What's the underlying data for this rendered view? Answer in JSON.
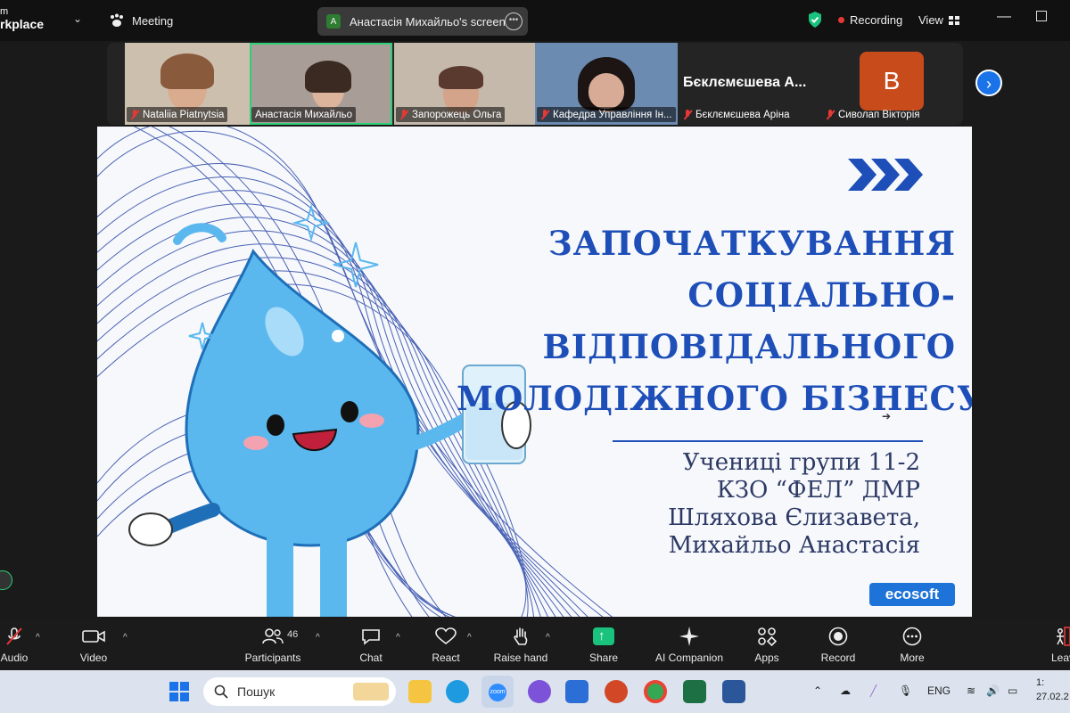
{
  "topbar": {
    "brand_line1": "m",
    "brand_line2": "rkplace",
    "meeting_label": "Meeting",
    "screen_share_avatar": "A",
    "screen_share_label": "Анастасія Михайльо's screen",
    "recording_label": "Recording",
    "view_label": "View"
  },
  "participants": [
    {
      "name": "Nataliia Piatnytsia",
      "muted": true
    },
    {
      "name": "Анастасія Михайльо",
      "muted": false,
      "active": true
    },
    {
      "name": "Запорожець Ольга",
      "muted": true
    },
    {
      "name": "Кафедра Управління Ін...",
      "muted": true
    },
    {
      "name": "Бєклємєшева Аріна",
      "muted": true,
      "display_title": "Бєклємєшева А..."
    },
    {
      "name": "Сиволап Вікторія",
      "muted": true,
      "avatar_letter": "B",
      "avatar_color": "#c84b1c"
    }
  ],
  "slide": {
    "title_lines": [
      "ЗАПОЧАТКУВАННЯ",
      "СОЦІАЛЬНО-",
      "ВІДПОВІДАЛЬНОГО",
      "МОЛОДІЖНОГО БІЗНЕСУ"
    ],
    "subtitle_lines": [
      "Учениці групи 11-2",
      "КЗО “ФЕЛ” ДМР",
      "Шляхова Єлизавета,",
      "Михайльо Анастасія"
    ],
    "logo_text": "ecosoft",
    "accent_color": "#1e4fb8"
  },
  "toolbar": {
    "audio": "Audio",
    "video": "Video",
    "participants": "Participants",
    "participants_count": "46",
    "chat": "Chat",
    "react": "React",
    "raise_hand": "Raise hand",
    "share": "Share",
    "ai_companion": "AI Companion",
    "apps": "Apps",
    "record": "Record",
    "more": "More",
    "leave": "Leav"
  },
  "taskbar": {
    "search_placeholder": "Пошук",
    "language": "ENG",
    "time": "1:",
    "date": "27.02.2"
  }
}
